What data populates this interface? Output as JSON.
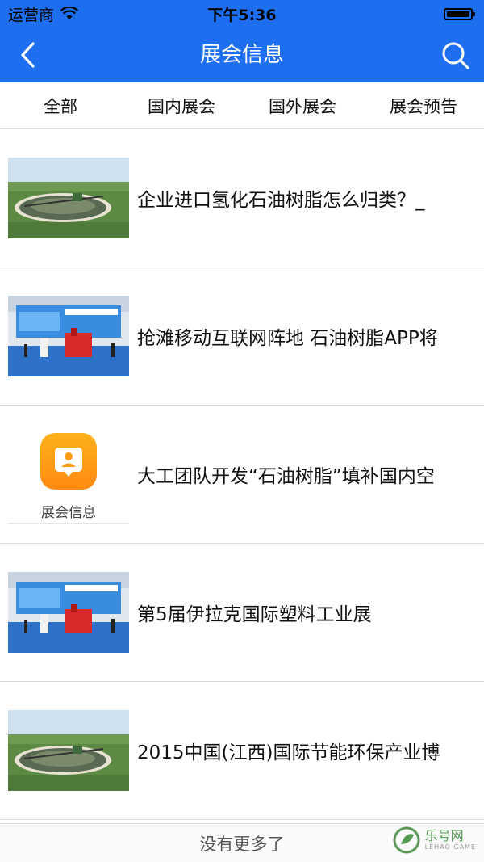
{
  "status_bar": {
    "carrier": "运营商",
    "time": "下午5:36"
  },
  "nav": {
    "title": "展会信息"
  },
  "tabs": [
    {
      "label": "全部"
    },
    {
      "label": "国内展会"
    },
    {
      "label": "国外展会"
    },
    {
      "label": "展会预告"
    }
  ],
  "items": [
    {
      "title": "企业进口氢化石油树脂怎么归类？_",
      "image": "water-treatment-photo"
    },
    {
      "title": "抢滩移动互联网阵地 石油树脂APP将",
      "image": "exhibition-booth-photo"
    },
    {
      "title": "大工团队开发“石油树脂”填补国内空",
      "image": "placeholder",
      "placeholder_label": "展会信息"
    },
    {
      "title": "第5届伊拉克国际塑料工业展",
      "image": "exhibition-booth-photo"
    },
    {
      "title": "2015中国(江西)国际节能环保产业博",
      "image": "water-treatment-photo"
    }
  ],
  "footer": {
    "text": "没有更多了"
  },
  "watermark": {
    "cn": "乐号网",
    "en": "LEHAO GAME"
  },
  "colors": {
    "accent": "#1e6ff0",
    "placeholder_icon": "#ff9a14"
  }
}
